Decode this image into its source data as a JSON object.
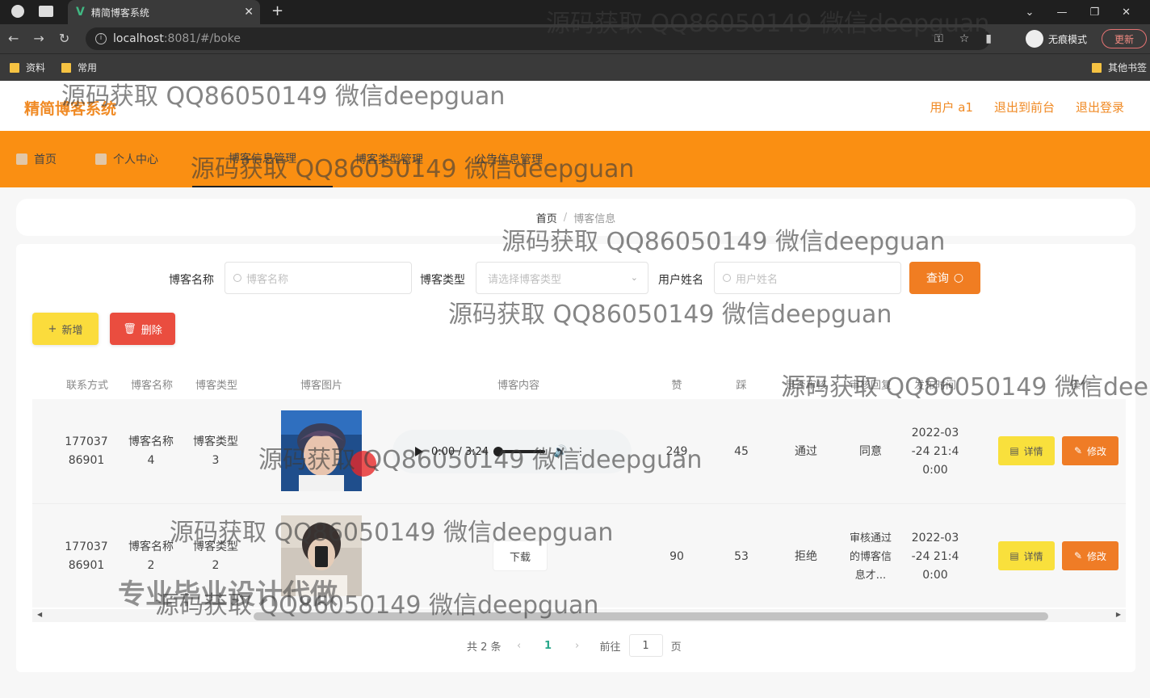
{
  "browser": {
    "tab_title": "精简博客系统",
    "url_host": "localhost",
    "url_rest": ":8081/#/boke",
    "incognito_label": "无痕模式",
    "update_label": "更新",
    "bookmarks": [
      "资料",
      "常用"
    ],
    "other_bookmarks": "其他书签"
  },
  "header": {
    "site_title": "精简博客系统",
    "user_label": "用户 a1",
    "back_front_label": "退出到前台",
    "logout_label": "退出登录"
  },
  "nav": {
    "home": "首页",
    "profile": "个人中心",
    "blog_mgmt": "博客信息管理",
    "category_mgmt": "博客类型管理",
    "notice_mgmt": "公告信息管理"
  },
  "breadcrumb": {
    "home": "首页",
    "sep": "/",
    "current": "博客信息"
  },
  "search": {
    "blog_name_label": "博客名称",
    "blog_name_placeholder": "博客名称",
    "blog_type_label": "博客类型",
    "blog_type_placeholder": "请选择博客类型",
    "user_name_label": "用户姓名",
    "user_name_placeholder": "用户姓名",
    "query_label": "查询"
  },
  "actions": {
    "add_label": "新增",
    "delete_label": "删除"
  },
  "table": {
    "columns": [
      "联系方式",
      "博客名称",
      "博客类型",
      "博客图片",
      "博客内容",
      "赞",
      "踩",
      "是否审核",
      "审核回复",
      "发布时间",
      "操作"
    ],
    "rows": [
      {
        "contact": "17703786901",
        "name": "博客名称4",
        "type": "博客类型3",
        "audio_time": "0:00 / 3:24",
        "likes": "249",
        "dislikes": "45",
        "audit": "通过",
        "reply": "同意",
        "time": "2022-03-24 21:40:00",
        "detail_label": "详情",
        "edit_label": "修改"
      },
      {
        "contact": "17703786901",
        "name": "博客名称2",
        "type": "博客类型2",
        "download_label": "下载",
        "likes": "90",
        "dislikes": "53",
        "audit": "拒绝",
        "reply": "审核通过的博客信息才...",
        "time": "2022-03-24 21:40:00",
        "detail_label": "详情",
        "edit_label": "修改"
      }
    ]
  },
  "pagination": {
    "total_label": "共 2 条",
    "current_page": "1",
    "goto_label": "前往",
    "goto_value": "1",
    "page_suffix": "页"
  },
  "watermarks": {
    "text": "源码获取 QQ86050149 微信deepguan",
    "big_text": "专业毕业设计代做"
  },
  "colors": {
    "brand_orange": "#fa8f12",
    "title_orange": "#f08a24",
    "add_yellow": "#fbdc3c",
    "delete_red": "#ea4d3f",
    "page_active": "#2aa78b"
  }
}
